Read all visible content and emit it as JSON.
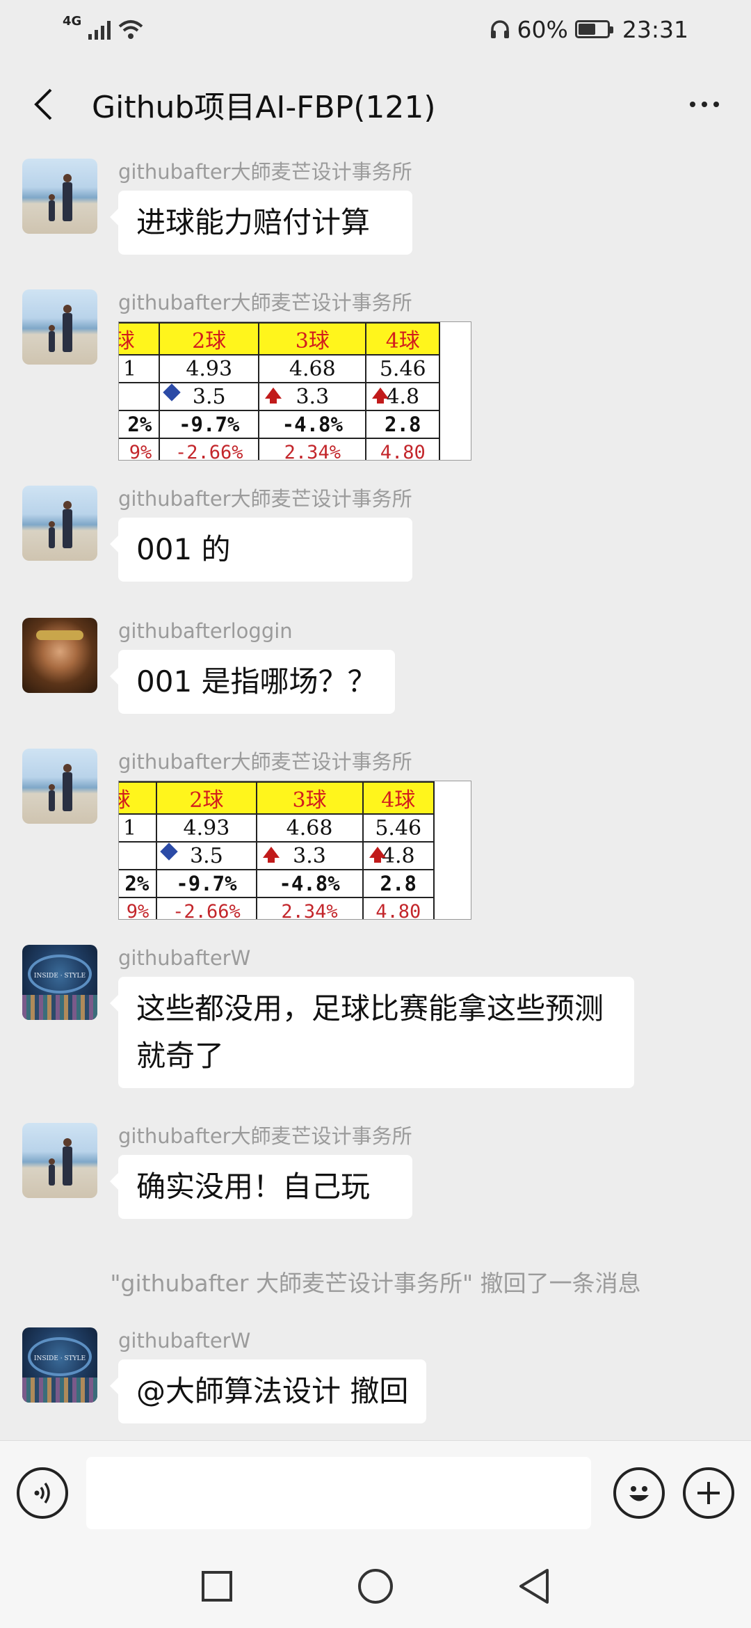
{
  "status_bar": {
    "network": "4G",
    "battery_percent": "60%",
    "battery_level": 0.6,
    "time": "23:31"
  },
  "header": {
    "title": "Github项目AI-FBP(121)"
  },
  "odds_table": {
    "header": [
      "球",
      "2球",
      "3球",
      "4球"
    ],
    "row1": [
      "1",
      "4.93",
      "4.68",
      "5.46"
    ],
    "row2": [
      "",
      "3.5",
      "3.3",
      "4.8"
    ],
    "row3": [
      "2%",
      "-9.7%",
      "-4.8%",
      "2.8"
    ],
    "row4": [
      "9%",
      "-2.66%",
      "2.34%",
      "4.80"
    ]
  },
  "messages": [
    {
      "sender": "githubafter大師麦芒设计事务所",
      "avatar": "beach-avatar",
      "text": "进球能力赔付计算"
    },
    {
      "sender": "githubafter大師麦芒设计事务所",
      "avatar": "beach-avatar",
      "image": "odds-table-image"
    },
    {
      "sender": "githubafter大師麦芒设计事务所",
      "avatar": "beach-avatar",
      "text": "001 的"
    },
    {
      "sender": "githubafterloggin",
      "avatar": "face-avatar",
      "text": "001 是指哪场？？"
    },
    {
      "sender": "githubafter大師麦芒设计事务所",
      "avatar": "beach-avatar",
      "image": "odds-table-image"
    },
    {
      "sender": "githubafterW",
      "avatar": "ocean-avatar",
      "text": "这些都没用，足球比赛能拿这些预测就奇了"
    },
    {
      "sender": "githubafter大師麦芒设计事务所",
      "avatar": "beach-avatar",
      "text": "确实没用！自己玩"
    },
    {
      "sender": "githubafterW",
      "avatar": "ocean-avatar",
      "text": "@大師算法设计  撤回"
    }
  ],
  "system_notice": "\"githubafter 大師麦芒设计事务所\" 撤回了一条消息",
  "input_bar": {
    "text_value": ""
  }
}
